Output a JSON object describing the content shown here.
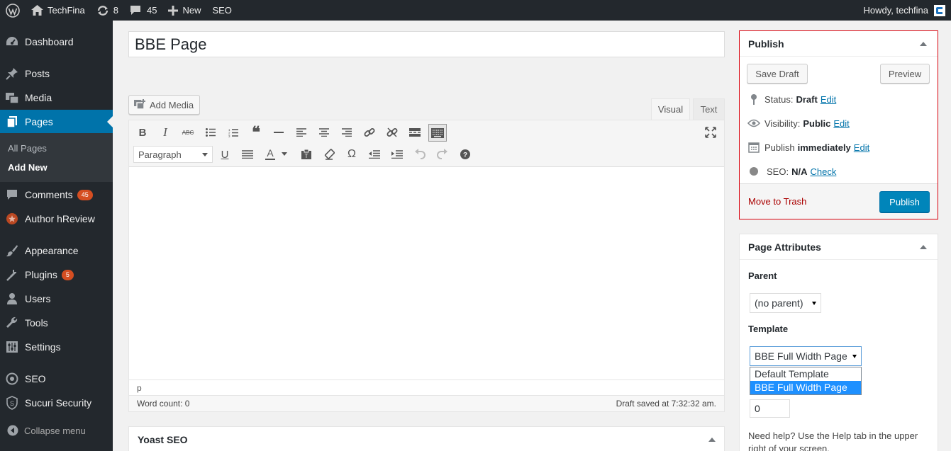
{
  "adminbar": {
    "site_name": "TechFina",
    "updates_count": "8",
    "comments_count": "45",
    "new_label": "New",
    "seo_label": "SEO",
    "howdy": "Howdy, techfina"
  },
  "sidebar": {
    "items": [
      {
        "label": "Dashboard"
      },
      {
        "label": "Posts"
      },
      {
        "label": "Media"
      },
      {
        "label": "Pages"
      },
      {
        "label": "Comments",
        "badge": "45"
      },
      {
        "label": "Author hReview"
      },
      {
        "label": "Appearance"
      },
      {
        "label": "Plugins",
        "badge": "5"
      },
      {
        "label": "Users"
      },
      {
        "label": "Tools"
      },
      {
        "label": "Settings"
      },
      {
        "label": "SEO"
      },
      {
        "label": "Sucuri Security"
      }
    ],
    "submenu": [
      "All Pages",
      "Add New"
    ],
    "collapse_label": "Collapse menu"
  },
  "editor": {
    "title_value": "BBE Page",
    "add_media_label": "Add Media",
    "tab_visual": "Visual",
    "tab_text": "Text",
    "format_select_value": "Paragraph",
    "path": "p",
    "word_count": "Word count: 0",
    "draft_saved": "Draft saved at 7:32:32 am."
  },
  "yoast": {
    "title": "Yoast SEO"
  },
  "publish": {
    "title": "Publish",
    "save_draft": "Save Draft",
    "preview": "Preview",
    "status_label": "Status:",
    "status_value": "Draft",
    "visibility_label": "Visibility:",
    "visibility_value": "Public",
    "publish_label": "Publish",
    "publish_value": "immediately",
    "seo_label": "SEO:",
    "seo_value": "N/A",
    "edit_label": "Edit",
    "check_label": "Check",
    "move_to_trash": "Move to Trash",
    "publish_button": "Publish"
  },
  "page_attributes": {
    "title": "Page Attributes",
    "parent_label": "Parent",
    "parent_value": "(no parent)",
    "template_label": "Template",
    "template_value": "BBE Full Width Page",
    "template_options": [
      "Default Template",
      "BBE Full Width Page"
    ],
    "order_value": "0",
    "help_text": "Need help? Use the Help tab in the upper right of your screen."
  },
  "colors": {
    "adminbar_bg": "#23282d",
    "menu_current": "#0073aa",
    "publish_button": "#0085ba",
    "highlight_border": "#d8000c",
    "badge": "#d54e21"
  }
}
